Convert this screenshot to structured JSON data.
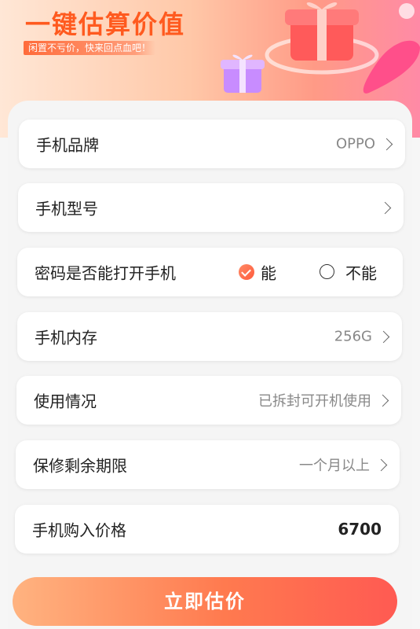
{
  "banner": {
    "title": "一键估算价值",
    "subtitle": "闲置不亏价，快来回点血吧！"
  },
  "form": {
    "brand": {
      "label": "手机品牌",
      "value": "OPPO"
    },
    "model": {
      "label": "手机型号",
      "value": ""
    },
    "password": {
      "label": "密码是否能打开手机",
      "option_yes": "能",
      "option_no": "不能",
      "selected": "能"
    },
    "storage": {
      "label": "手机内存",
      "value": "256G"
    },
    "usage": {
      "label": "使用情况",
      "value": "已拆封可开机使用"
    },
    "warranty": {
      "label": "保修剩余期限",
      "value": "一个月以上"
    },
    "price": {
      "label": "手机购入价格",
      "value": "6700"
    }
  },
  "cta": {
    "label": "立即估价"
  },
  "colors": {
    "accent": "#ff5a1f",
    "button_start": "#ffb380",
    "button_end": "#ff5a52"
  },
  "icons": {
    "chevron": "chevron-right-icon",
    "radio_checked": "radio-checked-icon",
    "radio_unchecked": "radio-unchecked-icon"
  }
}
